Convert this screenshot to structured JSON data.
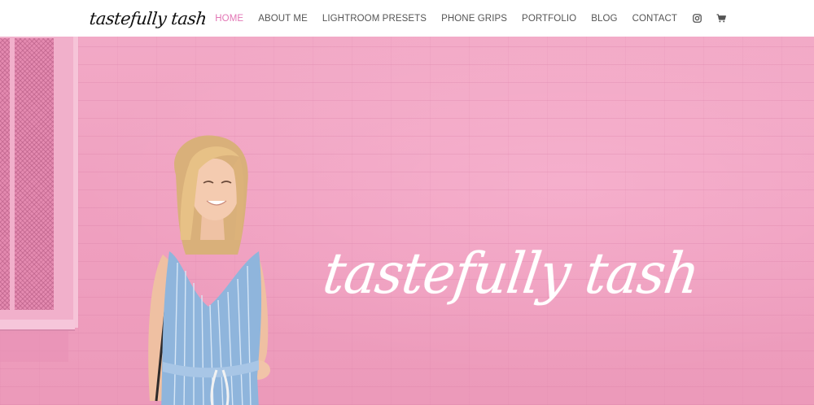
{
  "brand": {
    "logo_text": "tastefully tash"
  },
  "nav": {
    "items": [
      {
        "label": "HOME",
        "active": true
      },
      {
        "label": "ABOUT ME",
        "active": false
      },
      {
        "label": "LIGHTROOM PRESETS",
        "active": false
      },
      {
        "label": "PHONE GRIPS",
        "active": false
      },
      {
        "label": "PORTFOLIO",
        "active": false
      },
      {
        "label": "BLOG",
        "active": false
      },
      {
        "label": "CONTACT",
        "active": false
      }
    ],
    "icons": [
      "instagram-icon",
      "shopping-cart-icon"
    ]
  },
  "hero": {
    "title": "tastefully tash",
    "background": "pink brick wall",
    "subject": "woman in blue striped dress"
  },
  "colors": {
    "accent": "#e276b5",
    "nav_text": "#555555",
    "hero_pink": "#f0a5c3",
    "title_text": "#ffffff",
    "dress_blue": "#8fb5dc"
  }
}
